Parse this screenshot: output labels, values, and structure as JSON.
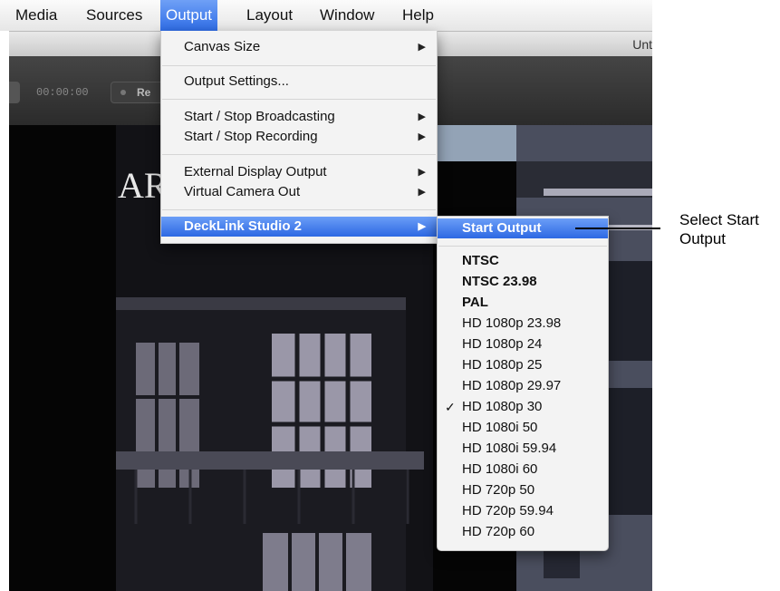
{
  "menubar": {
    "items": [
      "Media",
      "Sources",
      "Output",
      "Layout",
      "Window",
      "Help"
    ],
    "active": "Output"
  },
  "window": {
    "title": "Unt"
  },
  "toolbar": {
    "timer": "00:00:00",
    "record_label": "Re"
  },
  "output_menu": {
    "items": [
      {
        "label": "Canvas Size",
        "submenu": true
      },
      {
        "label": "Output Settings...",
        "submenu": false
      },
      {
        "label": "Start / Stop Broadcasting",
        "submenu": true
      },
      {
        "label": "Start / Stop Recording",
        "submenu": true
      },
      {
        "label": "External Display Output",
        "submenu": true
      },
      {
        "label": "Virtual Camera Out",
        "submenu": true
      },
      {
        "label": "DeckLink Studio 2",
        "submenu": true,
        "highlighted": true
      }
    ]
  },
  "decklink_submenu": {
    "start": "Start Output",
    "formats": [
      "NTSC",
      "NTSC 23.98",
      "PAL",
      "HD 1080p 23.98",
      "HD 1080p 24",
      "HD 1080p 25",
      "HD 1080p 29.97",
      "HD 1080p 30",
      "HD 1080i 50",
      "HD 1080i 59.94",
      "HD 1080i 60",
      "HD 720p 50",
      "HD 720p 59.94",
      "HD 720p 60"
    ],
    "selected": "HD 1080p 30"
  },
  "callout": {
    "text": "Select Start Output"
  },
  "canvas": {
    "sign_text": "AR"
  },
  "colors": {
    "highlight": "#3a74e8",
    "menu_bg": "#f3f3f3"
  }
}
